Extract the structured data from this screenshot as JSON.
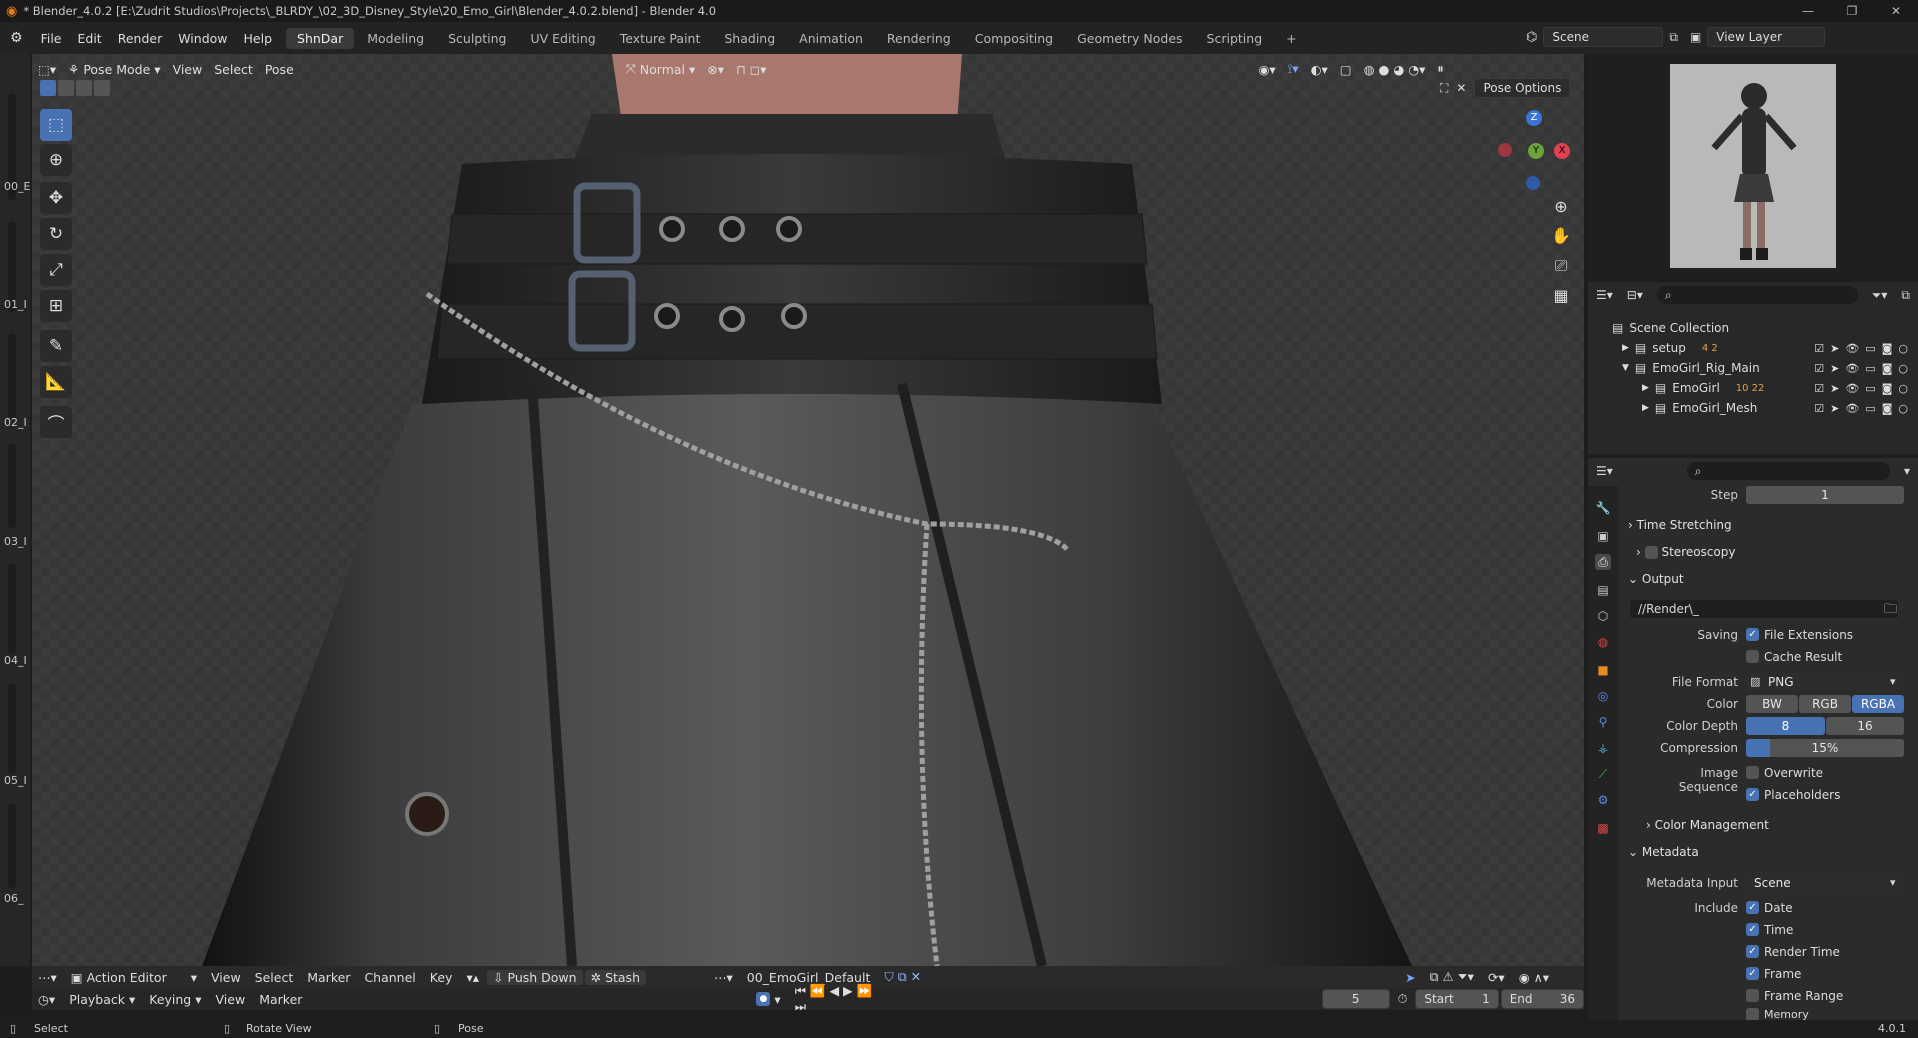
{
  "titlebar": {
    "title": "* Blender_4.0.2 [E:\\Zudrit Studios\\Projects\\_BLRDY_\\02_3D_Disney_Style\\20_Emo_Girl\\Blender_4.0.2.blend] - Blender 4.0"
  },
  "menu": [
    "File",
    "Edit",
    "Render",
    "Window",
    "Help"
  ],
  "workspaces": [
    "ShnDar",
    "Modeling",
    "Sculpting",
    "UV Editing",
    "Texture Paint",
    "Shading",
    "Animation",
    "Rendering",
    "Compositing",
    "Geometry Nodes",
    "Scripting"
  ],
  "active_workspace": "ShnDar",
  "scene": {
    "label": "Scene",
    "view_layer": "View Layer"
  },
  "viewport_header": {
    "mode": "Pose Mode",
    "view": "View",
    "select": "Select",
    "pose": "Pose",
    "orientation": "Normal",
    "pose_options": "Pose Options"
  },
  "gizmo": {
    "z": "Z",
    "y": "Y",
    "x": "X"
  },
  "left_strip": [
    "00_E",
    "01_I",
    "02_I",
    "03_I",
    "04_I",
    "05_I",
    "06_"
  ],
  "outliner": {
    "header": "Scene Collection",
    "rows": [
      {
        "name": "setup",
        "extra": "4 2"
      },
      {
        "name": "EmoGirl_Rig_Main",
        "extra": ""
      },
      {
        "name": "EmoGirl",
        "extra": "10 22"
      },
      {
        "name": "EmoGirl_Mesh",
        "extra": ""
      }
    ]
  },
  "properties": {
    "step_label": "Step",
    "step_value": "1",
    "time_stretching": "Time Stretching",
    "stereoscopy": "Stereoscopy",
    "output": "Output",
    "output_path": "//Render\\_",
    "saving_label": "Saving",
    "file_extensions": "File Extensions",
    "cache_result": "Cache Result",
    "file_format_label": "File Format",
    "file_format": "PNG",
    "color_label": "Color",
    "color_options": [
      "BW",
      "RGB",
      "RGBA"
    ],
    "color_active": "RGBA",
    "color_depth_label": "Color Depth",
    "color_depth": [
      "8",
      "16"
    ],
    "compression_label": "Compression",
    "compression": "15%",
    "compression_value": 0.15,
    "image_sequence_label": "Image Sequence",
    "overwrite": "Overwrite",
    "placeholders": "Placeholders",
    "color_management": "Color Management",
    "metadata": "Metadata",
    "metadata_input_label": "Metadata Input",
    "metadata_input": "Scene",
    "include_label": "Include",
    "include_items": [
      {
        "label": "Date",
        "checked": true
      },
      {
        "label": "Time",
        "checked": true
      },
      {
        "label": "Render Time",
        "checked": true
      },
      {
        "label": "Frame",
        "checked": true
      },
      {
        "label": "Frame Range",
        "checked": false
      },
      {
        "label": "Memory",
        "checked": false
      }
    ]
  },
  "action_editor": {
    "mode": "Action Editor",
    "view": "View",
    "select": "Select",
    "marker": "Marker",
    "channel": "Channel",
    "key": "Key",
    "push_down": "Push Down",
    "stash": "Stash",
    "action": "00_EmoGirl_Default"
  },
  "timeline": {
    "playback": "Playback",
    "keying": "Keying",
    "view": "View",
    "marker": "Marker",
    "current_frame": "5",
    "start_label": "Start",
    "start": "1",
    "end_label": "End",
    "end": "36"
  },
  "statusbar": {
    "select": "Select",
    "rotate": "Rotate View",
    "pose": "Pose",
    "version": "4.0.1"
  }
}
